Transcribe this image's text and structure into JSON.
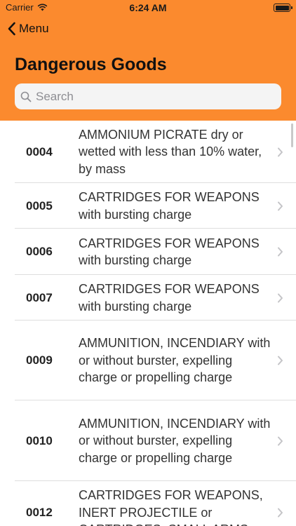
{
  "status_bar": {
    "carrier": "Carrier",
    "time": "6:24 AM"
  },
  "nav": {
    "back_label": "Menu",
    "title": "Dangerous Goods"
  },
  "search": {
    "placeholder": "Search",
    "value": ""
  },
  "items": [
    {
      "code": "0004",
      "description": "AMMONIUM PICRATE dry or wetted with less than 10% water, by mass"
    },
    {
      "code": "0005",
      "description": "CARTRIDGES FOR WEAPONS with bursting charge"
    },
    {
      "code": "0006",
      "description": "CARTRIDGES FOR WEAPONS with bursting charge"
    },
    {
      "code": "0007",
      "description": "CARTRIDGES FOR WEAPONS with bursting charge"
    },
    {
      "code": "0009",
      "description": "AMMUNITION, INCENDIARY with or without burster, expelling charge or propelling charge"
    },
    {
      "code": "0010",
      "description": "AMMUNITION, INCENDIARY with or without burster, expelling charge or propelling charge"
    },
    {
      "code": "0012",
      "description": "CARTRIDGES FOR WEAPONS, INERT PROJECTILE or CARTRIDGES, SMALL ARMS"
    }
  ],
  "colors": {
    "accent": "#fb8a2e",
    "separator": "#dedede"
  }
}
